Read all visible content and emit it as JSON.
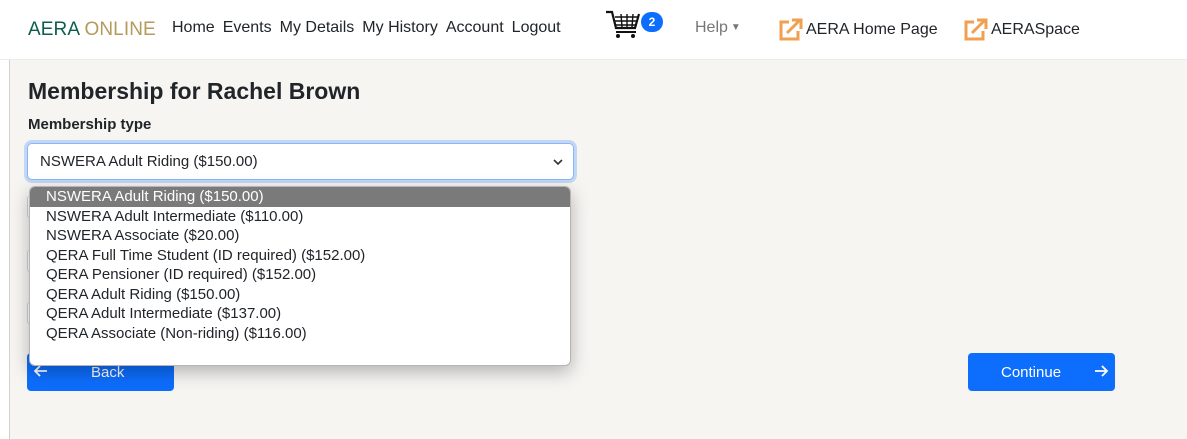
{
  "brand": {
    "part1": "AERA",
    "part2": "ONLINE"
  },
  "nav": [
    "Home",
    "Events",
    "My Details",
    "My History",
    "Account",
    "Logout"
  ],
  "cart": {
    "icon": "shopping-cart-icon",
    "count": "2"
  },
  "help": {
    "label": "Help"
  },
  "external_links": [
    {
      "label": "AERA Home Page",
      "icon": "external-link-icon"
    },
    {
      "label": "AERASpace",
      "icon": "external-link-icon"
    }
  ],
  "page": {
    "title": "Membership for Rachel Brown"
  },
  "form": {
    "membership_label": "Membership type",
    "selected_value": "NSWERA Adult Riding ($150.00)",
    "options": [
      "NSWERA Adult Riding ($150.00)",
      "NSWERA Adult Intermediate ($110.00)",
      "NSWERA Associate ($20.00)",
      "QERA Full Time Student (ID required) ($152.00)",
      "QERA Pensioner (ID required) ($152.00)",
      "QERA Adult Riding ($150.00)",
      "QERA Adult Intermediate ($137.00)",
      "QERA Associate (Non-riding) ($116.00)"
    ]
  },
  "buttons": {
    "back": "Back",
    "continue": "Continue"
  },
  "colors": {
    "primary": "#0d6efd",
    "brand_green": "#0e5c4e",
    "brand_gold": "#b59a5b",
    "link_icon": "#f0a050"
  }
}
